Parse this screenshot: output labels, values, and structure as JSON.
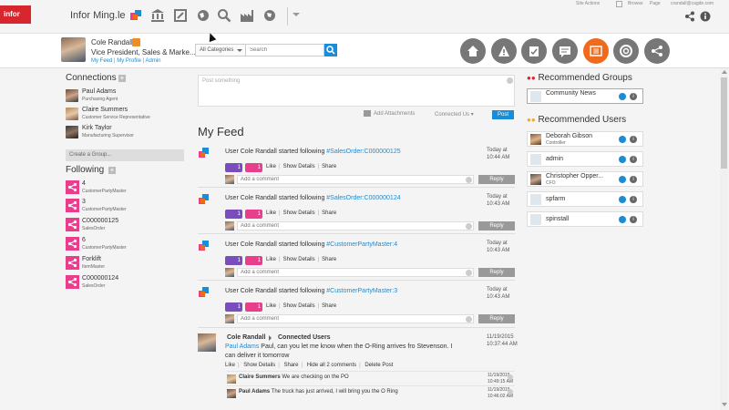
{
  "app": {
    "logo": "infor",
    "title": "Infor Ming.le"
  },
  "topright": {
    "site_actions": "Site Actions",
    "browse": "Browse",
    "page": "Page",
    "user": "crandall@cagde.com"
  },
  "profile": {
    "name": "Cole Randall",
    "title": "Vice President, Sales & Marke...",
    "links": [
      "My Feed",
      "My Profile",
      "Admin"
    ]
  },
  "search": {
    "category": "All Categories",
    "placeholder": "Search"
  },
  "connections": {
    "title": "Connections",
    "items": [
      {
        "name": "Paul Adams",
        "role": "Purchasing Agent"
      },
      {
        "name": "Claire Summers",
        "role": "Customer Service Representative"
      },
      {
        "name": "Kirk Taylor",
        "role": "Manufacturing Supervisor"
      }
    ],
    "create_group": "Create a Group..."
  },
  "following": {
    "title": "Following",
    "items": [
      {
        "name": "4",
        "type": "CustomerPartyMaster"
      },
      {
        "name": "3",
        "type": "CustomerPartyMaster"
      },
      {
        "name": "C000000125",
        "type": "SalesOrder"
      },
      {
        "name": "6",
        "type": "CustomerPartyMaster"
      },
      {
        "name": "Forklift",
        "type": "ItemMaster"
      },
      {
        "name": "C000000124",
        "type": "SalesOrder"
      }
    ]
  },
  "composer": {
    "placeholder": "Post something",
    "attach": "Add Attachments",
    "connected": "Connected Us",
    "post": "Post"
  },
  "feed": {
    "title": "My Feed",
    "entries": [
      {
        "prefix": "User Cole Randall started following ",
        "link": "#SalesOrder:C000000125",
        "date": "Today at",
        "time": "10:44 AM",
        "b1": "1",
        "b2": "1"
      },
      {
        "prefix": "User Cole Randall started following ",
        "link": "#SalesOrder:C000000124",
        "date": "Today at",
        "time": "10:43 AM",
        "b1": "1",
        "b2": "1"
      },
      {
        "prefix": "User Cole Randall started following ",
        "link": "#CustomerPartyMaster:4",
        "date": "Today at",
        "time": "10:43 AM",
        "b1": "1",
        "b2": "1"
      },
      {
        "prefix": "User Cole Randall started following ",
        "link": "#CustomerPartyMaster:3",
        "date": "Today at",
        "time": "10:43 AM",
        "b1": "1",
        "b2": "1"
      }
    ],
    "actions": {
      "like": "Like",
      "show_details": "Show Details",
      "share": "Share"
    },
    "comment_placeholder": "Add a comment",
    "reply": "Reply",
    "post": {
      "author": "Cole Randall",
      "target": "Connected Users",
      "mention": "Paul Adams",
      "text": " Paul, can you let me know when the O-Ring arrives fro Stevenson. I can deliver it tomorrow",
      "date": "11/19/2015",
      "time": "10:37:44 AM",
      "actions": [
        "Like",
        "Show Details",
        "Share",
        "Hide all 2 comments",
        "Delete Post"
      ],
      "comments": [
        {
          "author": "Claire Summers",
          "text": " We are checking on the PO",
          "date": "11/19/2015",
          "time": "10:49:15 AM"
        },
        {
          "author": "Paul Adams",
          "text": " The truck has just arrived, I will bring you the O Ring",
          "date": "11/19/2015",
          "time": "10:46:02 AM"
        }
      ]
    }
  },
  "recommended_groups": {
    "title": "Recommended Groups",
    "items": [
      {
        "name": "Community News"
      }
    ]
  },
  "recommended_users": {
    "title": "Recommended Users",
    "items": [
      {
        "name": "Deborah Gibson",
        "role": "Controller"
      },
      {
        "name": "admin",
        "role": ""
      },
      {
        "name": "Christopher Opper...",
        "role": "CFO"
      },
      {
        "name": "spfarm",
        "role": ""
      },
      {
        "name": "spinstall",
        "role": ""
      }
    ]
  },
  "colors": {
    "accent": "#f06a1d",
    "link": "#1a8dd6",
    "pink": "#e83e8c",
    "purple": "#7a4dbd",
    "brand": "#d8262e"
  }
}
